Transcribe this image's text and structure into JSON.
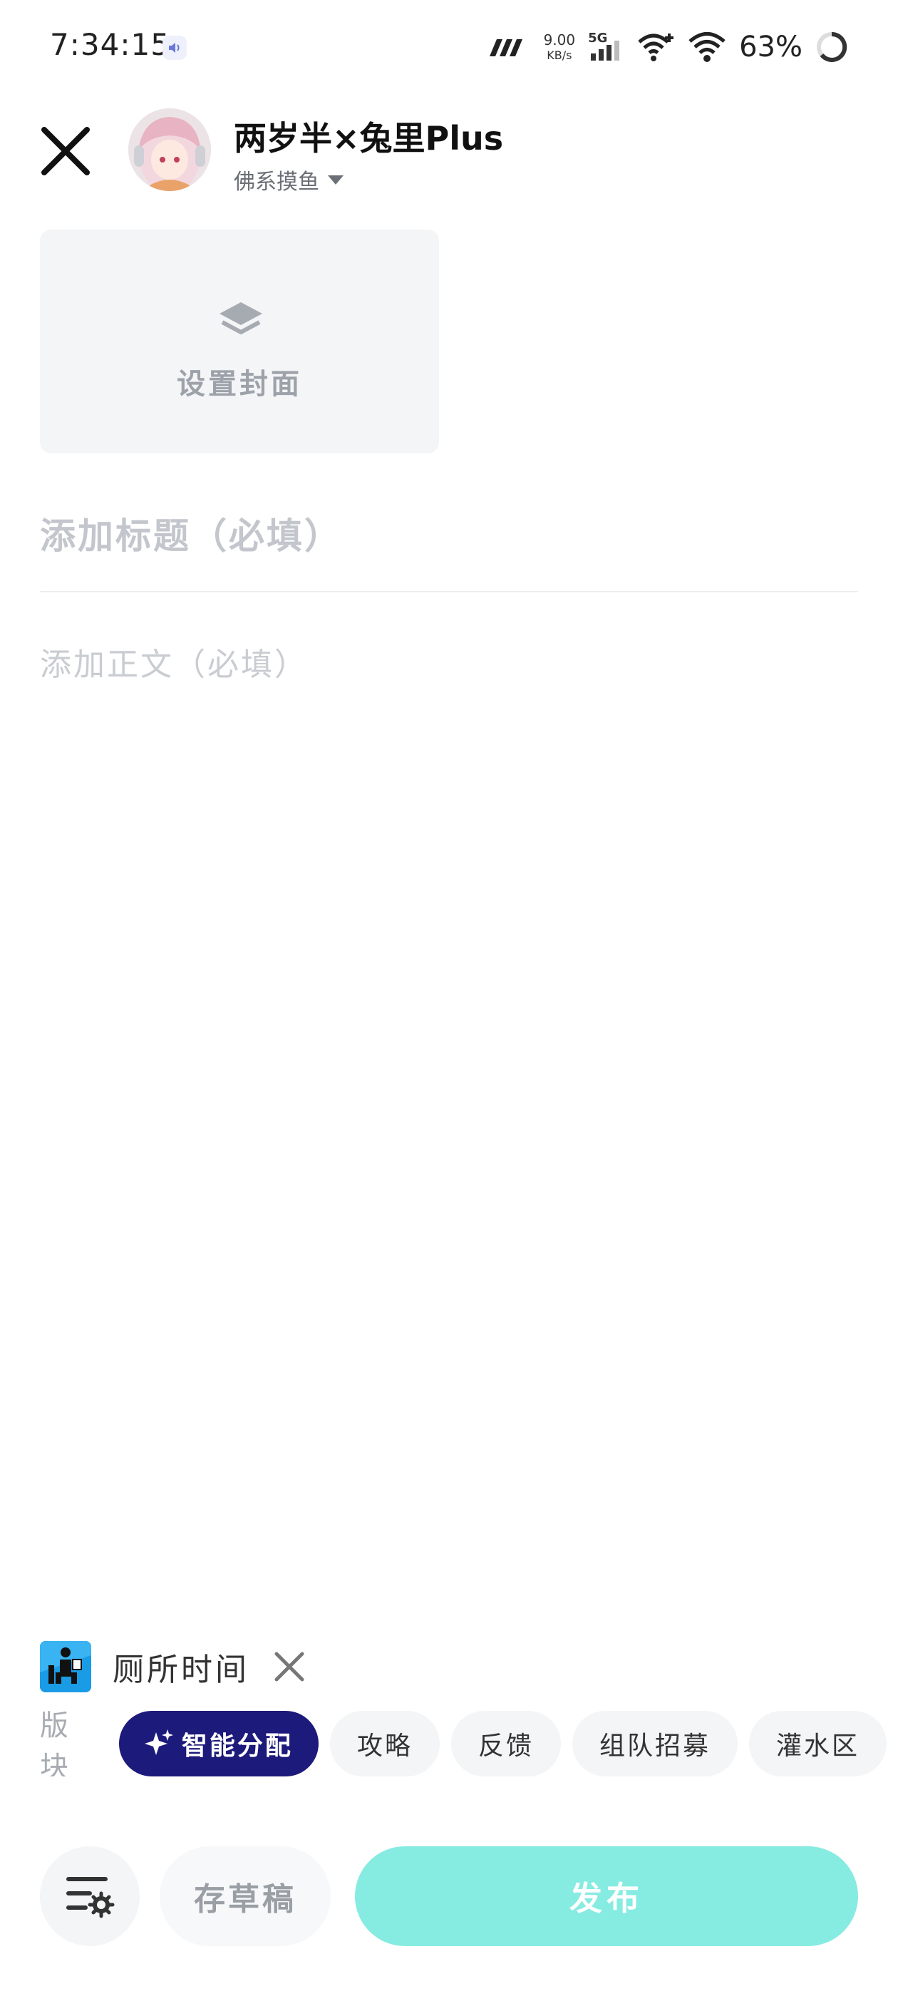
{
  "status_bar": {
    "time": "7:34:15",
    "net_speed_value": "9.00",
    "net_speed_unit": "KB/s",
    "network_type": "5G",
    "battery": "63%"
  },
  "header": {
    "user_name": "两岁半×兔里Plus",
    "community": "佛系摸鱼"
  },
  "cover": {
    "label": "设置封面"
  },
  "editor": {
    "title_placeholder": "添加标题（必填）",
    "body_placeholder": "添加正文（必填）"
  },
  "topic": {
    "label": "厕所时间"
  },
  "section": {
    "label": "版块",
    "chips": [
      {
        "label": "智能分配",
        "selected": true
      },
      {
        "label": "攻略",
        "selected": false
      },
      {
        "label": "反馈",
        "selected": false
      },
      {
        "label": "组队招募",
        "selected": false
      },
      {
        "label": "灌水区",
        "selected": false
      }
    ]
  },
  "actions": {
    "draft_label": "存草稿",
    "publish_label": "发布"
  },
  "colors": {
    "selected_chip": "#1c1a7a",
    "publish_button": "#86ebe1",
    "chip_bg": "#f4f5f7"
  },
  "icons": {
    "close": "close-icon",
    "cover": "layers-icon",
    "topic": "toilet-reading-icon",
    "sparkle": "sparkle-icon",
    "settings": "list-settings-icon"
  }
}
